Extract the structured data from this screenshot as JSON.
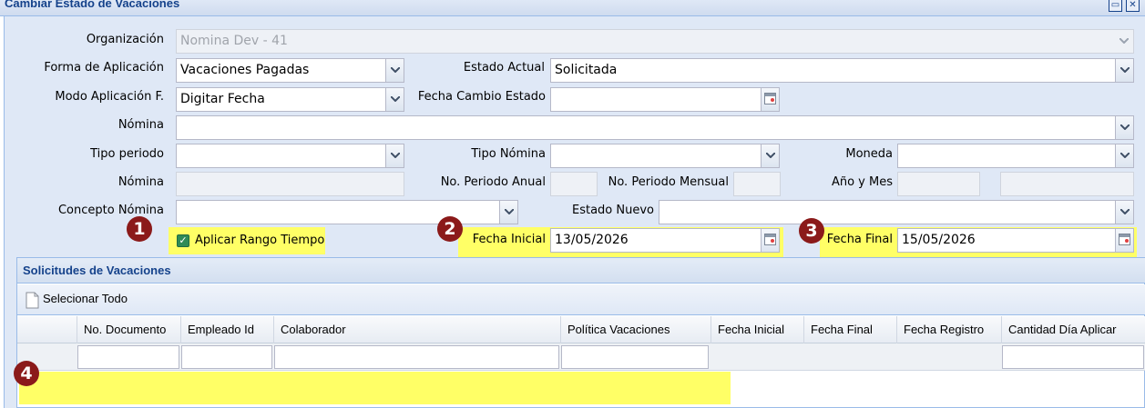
{
  "window": {
    "title": "Cambiar Estado de Vacaciones",
    "maximize_glyph": "▭",
    "close_glyph": "✕"
  },
  "form": {
    "organizacion": {
      "label": "Organización",
      "value": "Nomina Dev - 41"
    },
    "forma_aplicacion": {
      "label": "Forma de Aplicación",
      "value": "Vacaciones Pagadas"
    },
    "estado_actual": {
      "label": "Estado Actual",
      "value": "Solicitada"
    },
    "modo_aplicacion": {
      "label": "Modo Aplicación F.",
      "value": "Digitar Fecha"
    },
    "fecha_cambio_estado": {
      "label": "Fecha Cambio Estado",
      "value": ""
    },
    "nomina": {
      "label": "Nómina",
      "value": ""
    },
    "tipo_periodo": {
      "label": "Tipo periodo",
      "value": ""
    },
    "tipo_nomina": {
      "label": "Tipo Nómina",
      "value": ""
    },
    "moneda": {
      "label": "Moneda",
      "value": ""
    },
    "nomina2": {
      "label": "Nómina",
      "value": ""
    },
    "no_periodo_anual": {
      "label": "No. Periodo Anual",
      "value": ""
    },
    "no_periodo_mensual": {
      "label": "No. Periodo Mensual",
      "value": ""
    },
    "anio_mes": {
      "label": "Año y Mes",
      "value": ""
    },
    "concepto_nomina": {
      "label": "Concepto Nómina",
      "value": ""
    },
    "estado_nuevo": {
      "label": "Estado Nuevo",
      "value": ""
    },
    "aplicar_rango": {
      "label": "Aplicar Rango Tiempo",
      "checked": true
    },
    "fecha_inicial": {
      "label": "Fecha Inicial",
      "value": "13/05/2026"
    },
    "fecha_final": {
      "label": "Fecha Final",
      "value": "15/05/2026"
    }
  },
  "annotations": {
    "badge1": "1",
    "badge2": "2",
    "badge3": "3",
    "badge4": "4",
    "highlight_color": "#ffff66",
    "badge_color": "#8b1a1a"
  },
  "grid": {
    "title": "Solicitudes de Vacaciones",
    "toolbar": {
      "select_all": "Selecionar Todo"
    },
    "columns": [
      "No. Documento",
      "Empleado Id",
      "Colaborador",
      "Política Vacaciones",
      "Fecha Inicial",
      "Fecha Final",
      "Fecha Registro",
      "Cantidad Día Aplicar"
    ]
  },
  "colors": {
    "accent": "#15428b",
    "panel_bg": "#dfe8f6",
    "border": "#99bbe8",
    "checkbox": "#2e8b57"
  }
}
